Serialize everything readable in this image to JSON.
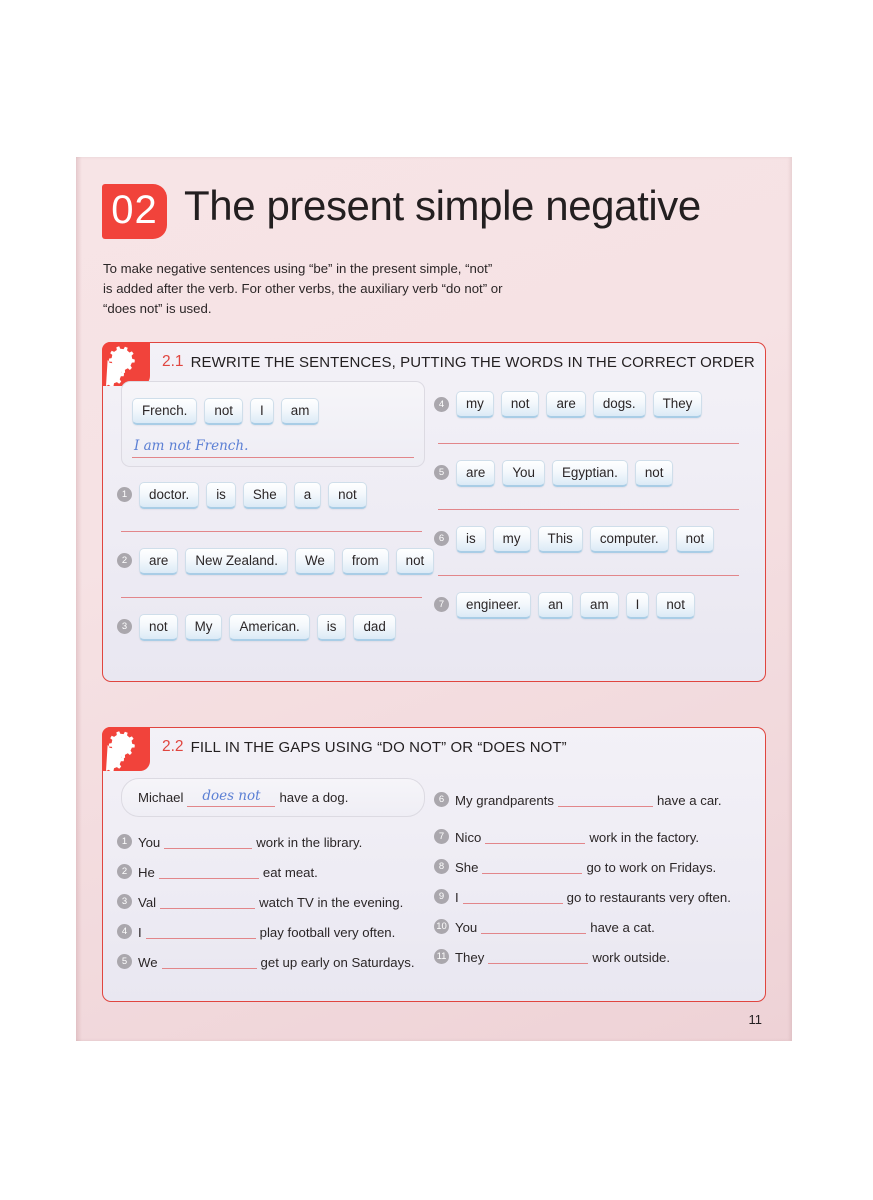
{
  "unit": {
    "number": "02",
    "title": "The present simple negative",
    "intro": "To make negative sentences using “be” in the present simple, “not” is added after the verb. For other verbs, the auxiliary verb “do not” or “does not” is used."
  },
  "colors": {
    "accent_red": "#f1433b",
    "panel_border": "#e0453f",
    "answer_line": "#e2868a",
    "handwriting_blue": "#5b7fd4",
    "badge_gray": "#aaa7ad",
    "page_bg": "#f4dfe2"
  },
  "exercise_21": {
    "number": "2.1",
    "label": "REWRITE THE SENTENCES, PUTTING THE WORDS IN THE CORRECT ORDER",
    "icon": "gears-icon",
    "example": {
      "tiles": [
        "French.",
        "not",
        "I",
        "am"
      ],
      "answer": "I am not French."
    },
    "left_items": [
      {
        "num": "1",
        "tiles": [
          "doctor.",
          "is",
          "She",
          "a",
          "not"
        ]
      },
      {
        "num": "2",
        "tiles": [
          "are",
          "New Zealand.",
          "We",
          "from",
          "not"
        ]
      },
      {
        "num": "3",
        "tiles": [
          "not",
          "My",
          "American.",
          "is",
          "dad"
        ]
      }
    ],
    "right_items": [
      {
        "num": "4",
        "tiles": [
          "my",
          "not",
          "are",
          "dogs.",
          "They"
        ]
      },
      {
        "num": "5",
        "tiles": [
          "are",
          "You",
          "Egyptian.",
          "not"
        ]
      },
      {
        "num": "6",
        "tiles": [
          "is",
          "my",
          "This",
          "computer.",
          "not"
        ]
      },
      {
        "num": "7",
        "tiles": [
          "engineer.",
          "an",
          "am",
          "I",
          "not"
        ]
      }
    ]
  },
  "exercise_22": {
    "number": "2.2",
    "label": "FILL IN THE GAPS USING “DO NOT” OR “DOES NOT”",
    "icon": "gears-icon",
    "example": {
      "before": "Michael",
      "answer": "does not",
      "after": "have a dog."
    },
    "left_items": [
      {
        "num": "1",
        "before": "You",
        "after": "work in the library.",
        "gap": 88
      },
      {
        "num": "2",
        "before": "He",
        "after": "eat meat.",
        "gap": 100
      },
      {
        "num": "3",
        "before": "Val",
        "after": "watch TV in the evening.",
        "gap": 95
      },
      {
        "num": "4",
        "before": "I",
        "after": "play football very often.",
        "gap": 110
      },
      {
        "num": "5",
        "before": "We",
        "after": "get up early on Saturdays.",
        "gap": 95
      }
    ],
    "right_items": [
      {
        "num": "6",
        "before": "My grandparents",
        "after": "have a car.",
        "gap": 95
      },
      {
        "num": "7",
        "before": "Nico",
        "after": "work in the factory.",
        "gap": 100
      },
      {
        "num": "8",
        "before": "She",
        "after": "go to work on Fridays.",
        "gap": 100
      },
      {
        "num": "9",
        "before": "I",
        "after": "go to restaurants very often.",
        "gap": 100
      },
      {
        "num": "10",
        "before": "You",
        "after": "have a cat.",
        "gap": 105
      },
      {
        "num": "11",
        "before": "They",
        "after": "work outside.",
        "gap": 100
      }
    ]
  },
  "page_number": "11"
}
